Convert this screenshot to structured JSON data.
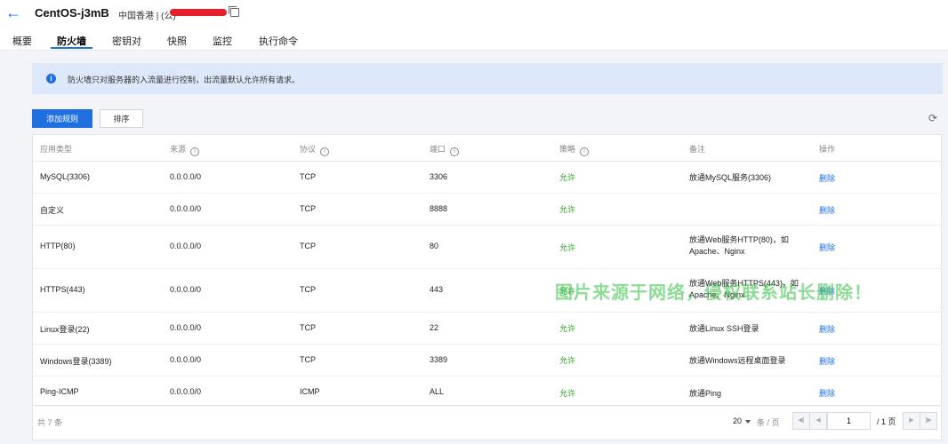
{
  "header": {
    "back_icon": "arrow-left-icon",
    "title": "CentOS-j3mB",
    "region": "中国香港 | (公)",
    "redacted_color": "#e5202a",
    "copy_icon": "copy-icon"
  },
  "tabs": [
    {
      "label": "概要",
      "active": false
    },
    {
      "label": "防火墙",
      "active": true
    },
    {
      "label": "密钥对",
      "active": false
    },
    {
      "label": "快照",
      "active": false
    },
    {
      "label": "监控",
      "active": false
    },
    {
      "label": "执行命令",
      "active": false
    }
  ],
  "notice": {
    "text": "防火墙只对服务器的入流量进行控制，出流量默认允许所有请求。",
    "icon": "info-icon"
  },
  "toolbar": {
    "add_label": "添加规则",
    "sort_label": "排序",
    "refresh_icon": "refresh-icon"
  },
  "table": {
    "headers": [
      "应用类型",
      "来源",
      "协议",
      "端口",
      "策略",
      "备注",
      "操作"
    ],
    "rows": [
      {
        "type": "MySQL(3306)",
        "source": "0.0.0.0/0",
        "protocol": "TCP",
        "port": "3306",
        "policy": "允许",
        "note": "放通MySQL服务(3306)",
        "action": "删除"
      },
      {
        "type": "自定义",
        "source": "0.0.0.0/0",
        "protocol": "TCP",
        "port": "8888",
        "policy": "允许",
        "note": "",
        "action": "删除"
      },
      {
        "type": "HTTP(80)",
        "source": "0.0.0.0/0",
        "protocol": "TCP",
        "port": "80",
        "policy": "允许",
        "note": "放通Web服务HTTP(80)，如Apache、Nginx",
        "action": "删除"
      },
      {
        "type": "HTTPS(443)",
        "source": "0.0.0.0/0",
        "protocol": "TCP",
        "port": "443",
        "policy": "允许",
        "note": "放通Web服务HTTPS(443)，如Apache、Nginx",
        "action": "删除"
      },
      {
        "type": "Linux登录(22)",
        "source": "0.0.0.0/0",
        "protocol": "TCP",
        "port": "22",
        "policy": "允许",
        "note": "放通Linux SSH登录",
        "action": "删除"
      },
      {
        "type": "Windows登录(3389)",
        "source": "0.0.0.0/0",
        "protocol": "TCP",
        "port": "3389",
        "policy": "允许",
        "note": "放通Windows远程桌面登录",
        "action": "删除"
      },
      {
        "type": "Ping-ICMP",
        "source": "0.0.0.0/0",
        "protocol": "ICMP",
        "port": "ALL",
        "policy": "允许",
        "note": "放通Ping",
        "action": "删除"
      }
    ]
  },
  "pagination": {
    "total": "共 7 条",
    "page_size": "20",
    "per_page": "条 / 页",
    "page": "1",
    "page_total": "/ 1 页"
  },
  "watermark": "图片来源于网络，侵权联系站长删除！",
  "colors": {
    "accent": "#1f6fe0",
    "allow": "#2ea121",
    "notice_bg": "#dde9fb"
  }
}
